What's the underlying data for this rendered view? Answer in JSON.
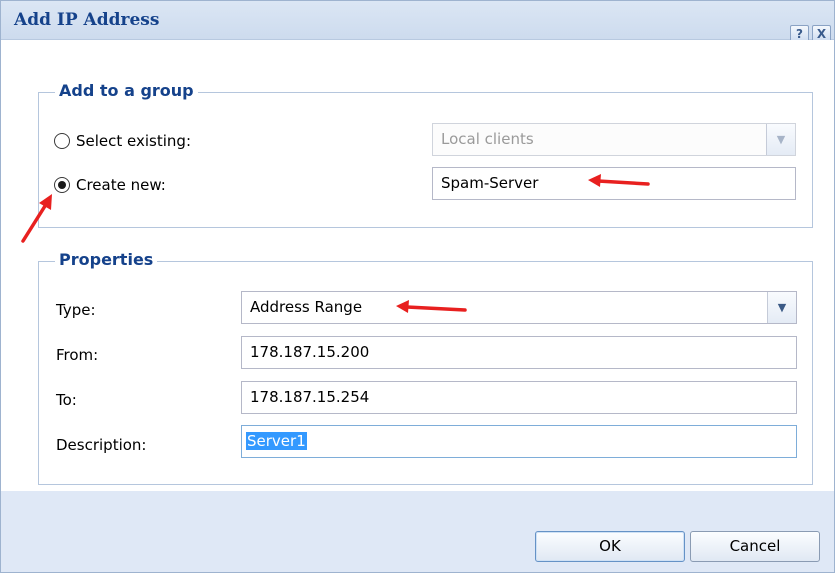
{
  "dialog": {
    "title": "Add IP Address",
    "help_glyph": "?",
    "close_glyph": "X"
  },
  "group_section": {
    "legend": "Add to a group",
    "select_existing_label": "Select existing:",
    "select_existing_value": "Local clients",
    "select_existing_checked": false,
    "create_new_label": "Create new:",
    "create_new_value": "Spam-Server",
    "create_new_checked": true
  },
  "properties_section": {
    "legend": "Properties",
    "type_label": "Type:",
    "type_value": "Address Range",
    "from_label": "From:",
    "from_value": "178.187.15.200",
    "to_label": "To:",
    "to_value": "178.187.15.254",
    "description_label": "Description:",
    "description_value": "Server1"
  },
  "buttons": {
    "ok": "OK",
    "cancel": "Cancel"
  },
  "colors": {
    "title_text": "#15428b",
    "annotation_arrow": "#e8201f",
    "frame_bg": "#dfe8f6",
    "selection": "#3399ff"
  },
  "icons": {
    "help": "help-icon",
    "close": "close-icon",
    "dropdown": "chevron-down-icon",
    "annotation": "red-arrow-annotation"
  }
}
